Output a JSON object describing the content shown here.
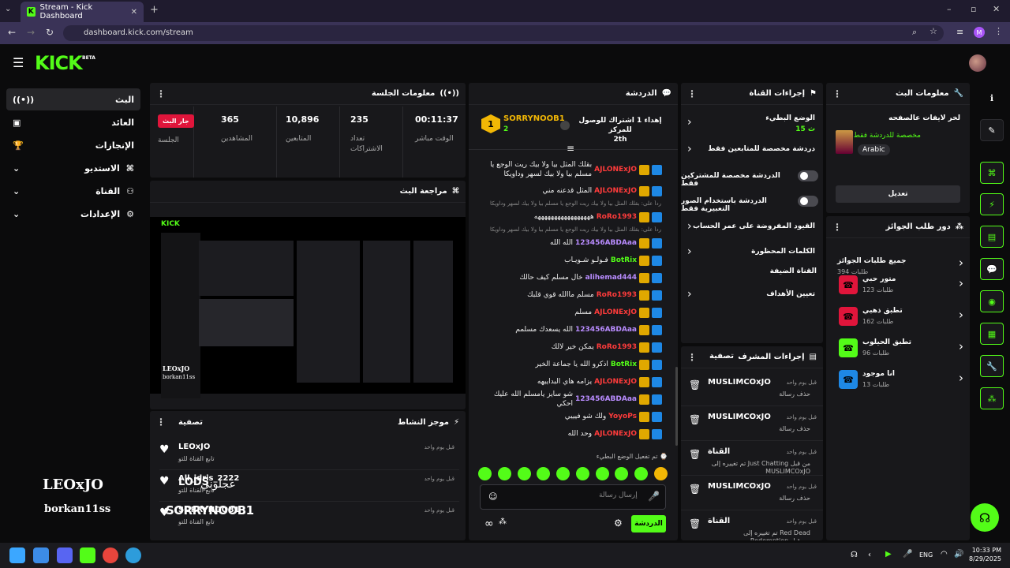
{
  "browser": {
    "tab_title": "Stream - Kick Dashboard",
    "url": "dashboard.kick.com/stream",
    "profile_initial": "M"
  },
  "header": {
    "logo": "KICK",
    "beta": "BETA"
  },
  "nav": [
    {
      "label": "البث",
      "active": true
    },
    {
      "label": "العائد"
    },
    {
      "label": "الإنجازات"
    },
    {
      "label": "الاستديو"
    },
    {
      "label": "القناة"
    },
    {
      "label": "الإعدادات"
    }
  ],
  "session": {
    "title": "معلومات الجلسة",
    "stats": [
      {
        "value": "00:11:37",
        "label": "الوقت مباشر"
      },
      {
        "value": "235",
        "label": "تعداد الاشتراكات"
      },
      {
        "value": "10,896",
        "label": "المتابعين"
      },
      {
        "value": "365",
        "label": "المشاهدين"
      }
    ],
    "live_badge": "جار البث",
    "session_label": "الجلسة"
  },
  "preview": {
    "title": "مراجعة البث",
    "streamer_name": "LEOxJO",
    "streamer_sub": "borkan11ss"
  },
  "activity": {
    "title": "موجز النشاط",
    "filter": "تصفية",
    "items": [
      {
        "name": "LEOxJO",
        "sub": "تابع القناة للتو",
        "time": "قبل يوم واحد"
      },
      {
        "name": "All_idris_2222",
        "sub": "تابع القناة للتو",
        "time": "قبل يوم واحد"
      },
      {
        "name": "SORRYNOOB1",
        "sub": "تابع القناة للتو",
        "time": "قبل يوم واحد"
      }
    ]
  },
  "overlay": {
    "name": "LEOxJO",
    "sub": "borkan11ss",
    "arabic_name": "عجلوني",
    "clan": "LODS",
    "second_name": "SORRYNOOB1"
  },
  "chat": {
    "title": "الدردشة",
    "pinned_user": "SORRYNOOB1",
    "pinned_count": "2",
    "pinned_text": "إهداء 1 اشتراك للوصول للمركز",
    "pinned_rank": "2th",
    "messages": [
      {
        "user": "AJLONExJO",
        "color": "#ff3b3b",
        "text": "بقلك المثل بيا ولا بيك ريت الوجع يا مسلم بيا ولا بيك لسهر وداويكا"
      },
      {
        "user": "AJLONExJO",
        "color": "#ff3b3b",
        "text": "المثل قدعنه مني"
      },
      {
        "user": "RoRo1993",
        "color": "#ff3b3b",
        "text": "هههههههههههههههههه"
      },
      {
        "user": "123456ABDAaa",
        "color": "#b98cff",
        "text": "الله الله"
      },
      {
        "user": "BotRix",
        "color": "#53fc18",
        "text": "فـولـو شـويـاب"
      },
      {
        "user": "alihemad444",
        "color": "#b98cff",
        "text": "خال مسلم كيف حالك"
      },
      {
        "user": "RoRo1993",
        "color": "#ff3b3b",
        "text": "مسلم ماالله قوي قلبك"
      },
      {
        "user": "AJLONExJO",
        "color": "#ff3b3b",
        "text": "مسلم"
      },
      {
        "user": "123456ABDAaa",
        "color": "#b98cff",
        "text": "الله يسعدك مسلمم"
      },
      {
        "user": "RoRo1993",
        "color": "#ff3b3b",
        "text": "يمكن خير لالك"
      },
      {
        "user": "BotRix",
        "color": "#53fc18",
        "text": "اذكرو الله يا جماعة الخير"
      },
      {
        "user": "AJLONExJO",
        "color": "#ff3b3b",
        "text": "يزامه هاي البداييهه"
      },
      {
        "user": "123456ABDAaa",
        "color": "#b98cff",
        "text": "شو سايز يامسلم الله عليك احكي"
      },
      {
        "user": "YoyoPs",
        "color": "#ff3b3b",
        "text": "ولك شو فيييي"
      },
      {
        "user": "AJLONExJO",
        "color": "#ff3b3b",
        "text": "وحد الله"
      }
    ],
    "reply1": "رداً على: بقلك المثل بيا ولا بيك ريت الوجع يا مسلم بيا ولا بيك لسهر وداويكا",
    "reply2": "رداً على: بقلك المثل بيا ولا بيك ريت الوجع يا مسلم بيا ولا بيك لسهر وداويكا",
    "slow_mode_notice": "تم تفعيل الوضع البطيء",
    "input_placeholder": "إرسال رسالة",
    "send_label": "الدردشة"
  },
  "channel_actions": {
    "title": "إجراءات القناة",
    "slow_mode": "الوضع البطيء",
    "slow_value": "15 ث",
    "followers_only": "دردشة مخصصة للمتابعين فقط",
    "subs_only": "الدردشة مخصصة للمشتركين فقط",
    "emotes_only": "الدردشة باستخدام الصور التعبيرية فقط",
    "account_age": "القيود المفروضة على عمر الحساب",
    "banned_words": "الكلمات المحظورة",
    "pinned_channel": "القناة الضيفة",
    "goals": "تعيين الأهداف"
  },
  "mod_actions": {
    "title": "إجراءات المشرف",
    "filter": "تصفية",
    "items": [
      {
        "user": "MUSLIMCOxJO",
        "action": "حذف رسالة",
        "time": "قبل يوم واحد"
      },
      {
        "user": "MUSLIMCOxJO",
        "action": "حذف رسالة",
        "time": "قبل يوم واحد"
      },
      {
        "user": "القناة",
        "action": "تم تغييره إلى Just Chatting من قبل MUSLIMCOxJO",
        "time": "قبل يوم واحد"
      },
      {
        "user": "MUSLIMCOxJO",
        "action": "حذف رسالة",
        "time": "قبل يوم واحد"
      },
      {
        "user": "القناة",
        "action": "تم تغييره إلى Red Dead Redemption من قبل MUSLIMCOxJO",
        "time": "قبل يوم واحد"
      }
    ]
  },
  "stream_info": {
    "title": "معلومات البث",
    "subtitle": "لخر لايفات عالصفحه",
    "category": "مخصصة للدردشة فقط",
    "language": "Arabic",
    "edit": "تعديل"
  },
  "rewards": {
    "title": "دور طلب الجوائز",
    "all": {
      "name": "جميع طلبات الجوائز",
      "count": "394 طلبات"
    },
    "items": [
      {
        "name": "متور حبي",
        "count": "123 طلبات",
        "color": "#e0153b"
      },
      {
        "name": "تطبق ذهبي",
        "count": "162 طلبات",
        "color": "#e0153b"
      },
      {
        "name": "تطبق الحيلوب",
        "count": "96 طلبات",
        "color": "#53fc18"
      },
      {
        "name": "انا موجود",
        "count": "13 طلبات",
        "color": "#1e88e5"
      }
    ]
  },
  "taskbar": {
    "lang": "ENG",
    "time": "10:33 PM",
    "date": "8/29/2025"
  },
  "colors": {
    "accent": "#53fc18",
    "panel": "#18181b"
  }
}
